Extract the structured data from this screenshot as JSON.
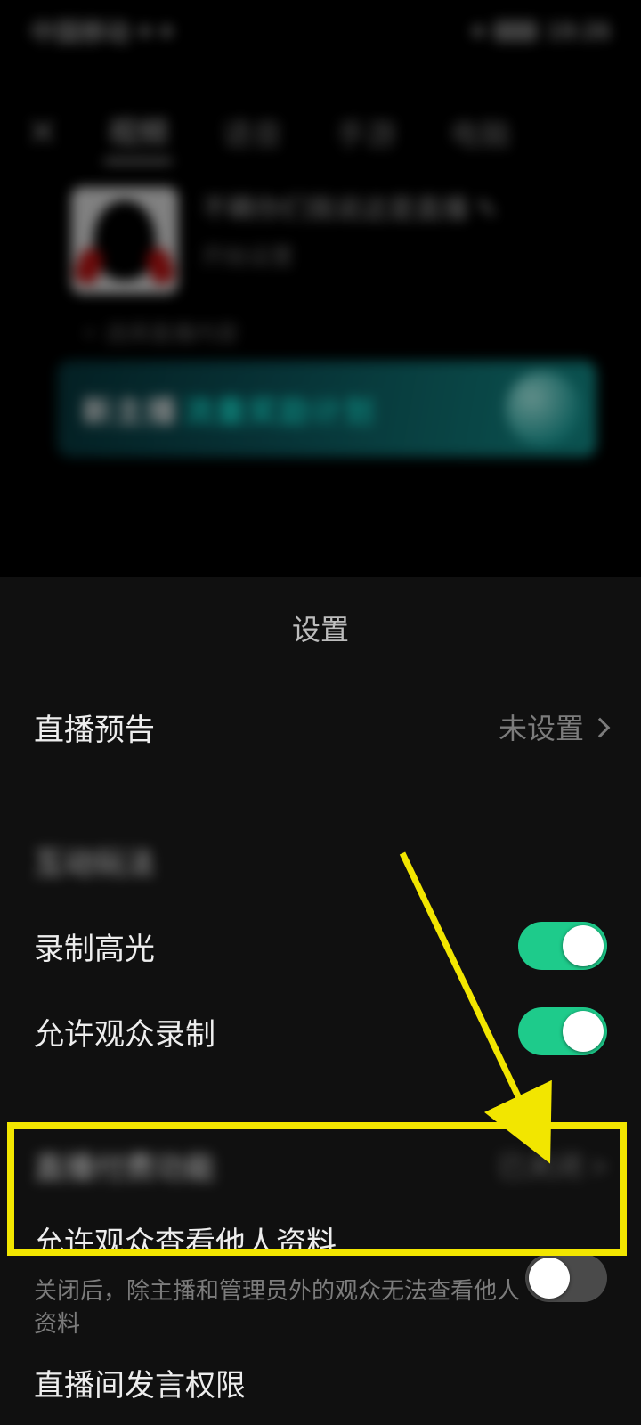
{
  "status_time": "19:26",
  "tabs": [
    "视频",
    "语音",
    "手游",
    "电脑"
  ],
  "active_tab_index": 0,
  "profile": {
    "name_line": "不瞒你们我说这是直播 ✎",
    "sub_line1": "开始设置",
    "sub_line2": "✧ 选择直播内容"
  },
  "banner": {
    "white": "新主播",
    "teal": "流量奖励计划"
  },
  "sheet": {
    "title": "设置",
    "rows": {
      "preview": {
        "label": "直播预告",
        "value": "未设置"
      },
      "blurred1": {
        "label": "互动玩法"
      },
      "record_highlight": {
        "label": "录制高光",
        "on": true
      },
      "allow_record": {
        "label": "允许观众录制",
        "on": true
      },
      "blurred2": {
        "label": "直播付费功能",
        "value": "已关闭 >"
      },
      "view_profile": {
        "label": "允许观众查看他人资料",
        "sub": "关闭后，除主播和管理员外的观众无法查看他人资料",
        "on": false
      },
      "speak_perm": {
        "label": "直播间发言权限"
      }
    }
  }
}
